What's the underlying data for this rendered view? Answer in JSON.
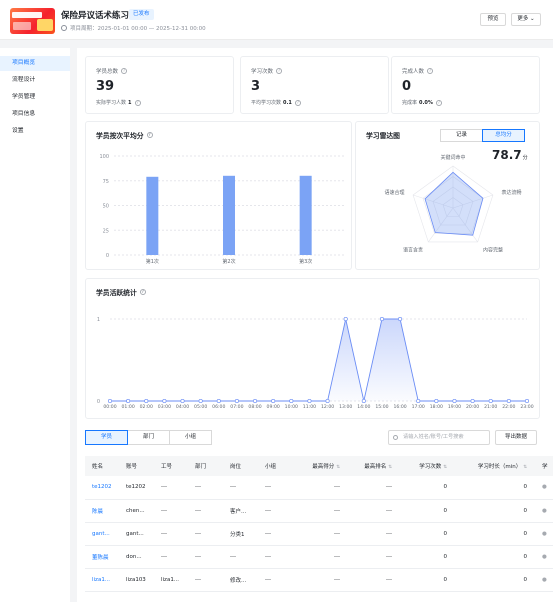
{
  "header": {
    "title": "保险异议话术练习",
    "status": "已发布",
    "period": "项目周期：2025-01-01 00:00 — 2025-12-31 00:00",
    "preview_label": "预览",
    "more_label": "更多 ⌄"
  },
  "sidebar": {
    "items": [
      {
        "label": "项目概览",
        "active": true
      },
      {
        "label": "流程设计"
      },
      {
        "label": "学员管理"
      },
      {
        "label": "项目信息"
      },
      {
        "label": "设置"
      }
    ]
  },
  "stats": [
    {
      "label": "学员总数",
      "value": "39",
      "sub_label": "实际学习人数",
      "sub_value": "1"
    },
    {
      "label": "学习次数",
      "value": "3",
      "sub_label": "平均学习次数",
      "sub_value": "0.1"
    },
    {
      "label": "完成人数",
      "value": "0",
      "sub_label": "完成率",
      "sub_value": "0.0%"
    }
  ],
  "avg_chart": {
    "title": "学员按次平均分",
    "chart_data": {
      "type": "bar",
      "categories": [
        "第1次",
        "第2次",
        "第3次"
      ],
      "values": [
        79,
        80,
        80
      ],
      "ylim": [
        0,
        100
      ],
      "yticks": [
        "0",
        "25",
        "50",
        "75",
        "100"
      ],
      "color": "#7ba3f5"
    }
  },
  "radar": {
    "title": "学习雷达图",
    "toggle": {
      "options": [
        "记录",
        "总均分"
      ],
      "active": "总均分"
    },
    "score": "78.7",
    "unit": "分",
    "chart_data": {
      "type": "radar",
      "axes": [
        "关键词命中",
        "表达流畅",
        "内容完整",
        "语言含责",
        "语速合理"
      ],
      "values": [
        0.85,
        0.75,
        0.8,
        0.72,
        0.7
      ]
    }
  },
  "activity": {
    "title": "学员活跃统计",
    "chart_data": {
      "type": "area",
      "x": [
        "00:00",
        "01:00",
        "02:00",
        "03:00",
        "04:00",
        "05:00",
        "06:00",
        "07:00",
        "08:00",
        "09:00",
        "10:00",
        "11:00",
        "12:00",
        "13:00",
        "14:00",
        "15:00",
        "16:00",
        "17:00",
        "18:00",
        "19:00",
        "20:00",
        "21:00",
        "22:00",
        "23:00"
      ],
      "y": [
        0,
        0,
        0,
        0,
        0,
        0,
        0,
        0,
        0,
        0,
        0,
        0,
        0,
        1,
        0,
        1,
        1,
        0,
        0,
        0,
        0,
        0,
        0,
        0
      ],
      "yticks": [
        "0",
        "1"
      ],
      "color": "#6b8df5"
    }
  },
  "tabs": [
    {
      "label": "学员",
      "active": true
    },
    {
      "label": "部门"
    },
    {
      "label": "小组"
    }
  ],
  "search": {
    "placeholder": "请输入姓名/账号/工号搜索"
  },
  "export_label": "导出数据",
  "table": {
    "headers": [
      "姓名",
      "账号",
      "工号",
      "部门",
      "岗位",
      "小组",
      "最高得分",
      "最高排名",
      "学习次数",
      "学习时长（min）",
      "学"
    ],
    "rows": [
      [
        "te1202",
        "te1202",
        "---",
        "---",
        "---",
        "---",
        "---",
        "---",
        "0",
        "0"
      ],
      [
        "陈晨",
        "chen...",
        "---",
        "---",
        "客户...",
        "---",
        "---",
        "---",
        "0",
        "0"
      ],
      [
        "gant...",
        "gant...",
        "---",
        "---",
        "分类1",
        "---",
        "---",
        "---",
        "0",
        "0"
      ],
      [
        "董陈晨",
        "don...",
        "---",
        "---",
        "---",
        "---",
        "---",
        "---",
        "0",
        "0"
      ],
      [
        "liza1...",
        "liza103",
        "liza1...",
        "---",
        "修改...",
        "---",
        "---",
        "---",
        "0",
        "0"
      ]
    ]
  }
}
